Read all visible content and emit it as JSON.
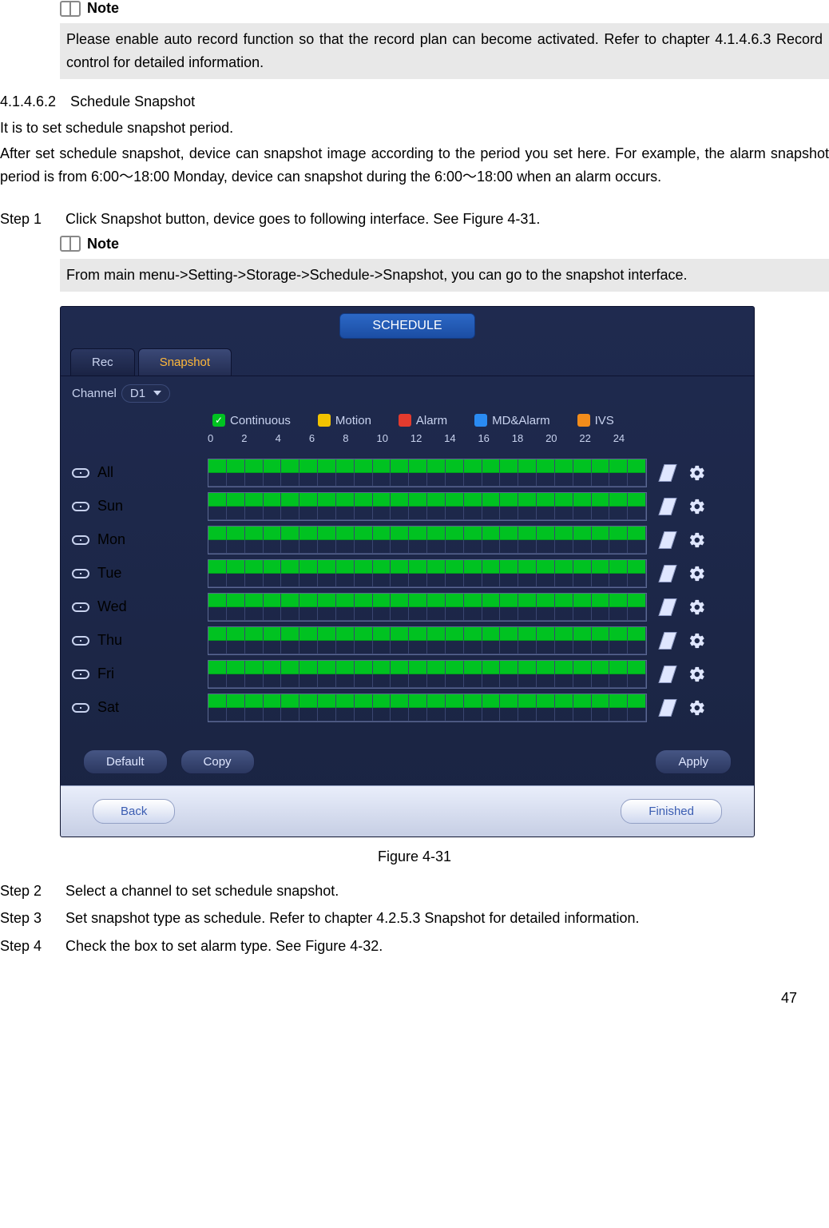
{
  "notes": {
    "label": "Note",
    "note1": "Please enable auto record function so that the record plan can become activated. Refer to chapter 4.1.4.6.3 Record control for detailed information.",
    "note2": "From main menu->Setting->Storage->Schedule->Snapshot, you can go to the snapshot interface."
  },
  "section": {
    "heading": "4.1.4.6.2 Schedule Snapshot",
    "p1": "It is to set schedule snapshot period.",
    "p2": "After set schedule snapshot, device can snapshot image according to the period you set here. For example, the alarm snapshot period is from 6:00～18:00 Monday, device can snapshot during the 6:00～18:00 when an alarm occurs."
  },
  "steps": {
    "s1_label": "Step 1",
    "s1_text": "Click Snapshot button, device goes to following interface. See Figure 4-31.",
    "s2_label": "Step 2",
    "s2_text": "Select a channel to set schedule snapshot.",
    "s3_label": "Step 3",
    "s3_text": "Set snapshot type as schedule. Refer to chapter 4.2.5.3 Snapshot for detailed information.",
    "s4_label": "Step 4",
    "s4_text": "Check the box to set alarm type. See Figure 4-32."
  },
  "schedule": {
    "title": "SCHEDULE",
    "tabs": {
      "rec": "Rec",
      "snapshot": "Snapshot"
    },
    "channel_label": "Channel",
    "channel_value": "D1",
    "legend": {
      "continuous": "Continuous",
      "motion": "Motion",
      "alarm": "Alarm",
      "mdalarm": "MD&Alarm",
      "ivs": "IVS"
    },
    "hours": [
      "0",
      "2",
      "4",
      "6",
      "8",
      "10",
      "12",
      "14",
      "16",
      "18",
      "20",
      "22",
      "24"
    ],
    "days": [
      "All",
      "Sun",
      "Mon",
      "Tue",
      "Wed",
      "Thu",
      "Fri",
      "Sat"
    ],
    "buttons": {
      "default": "Default",
      "copy": "Copy",
      "apply": "Apply",
      "back": "Back",
      "finished": "Finished"
    }
  },
  "figure_caption": "Figure 4-31",
  "page_number": "47"
}
